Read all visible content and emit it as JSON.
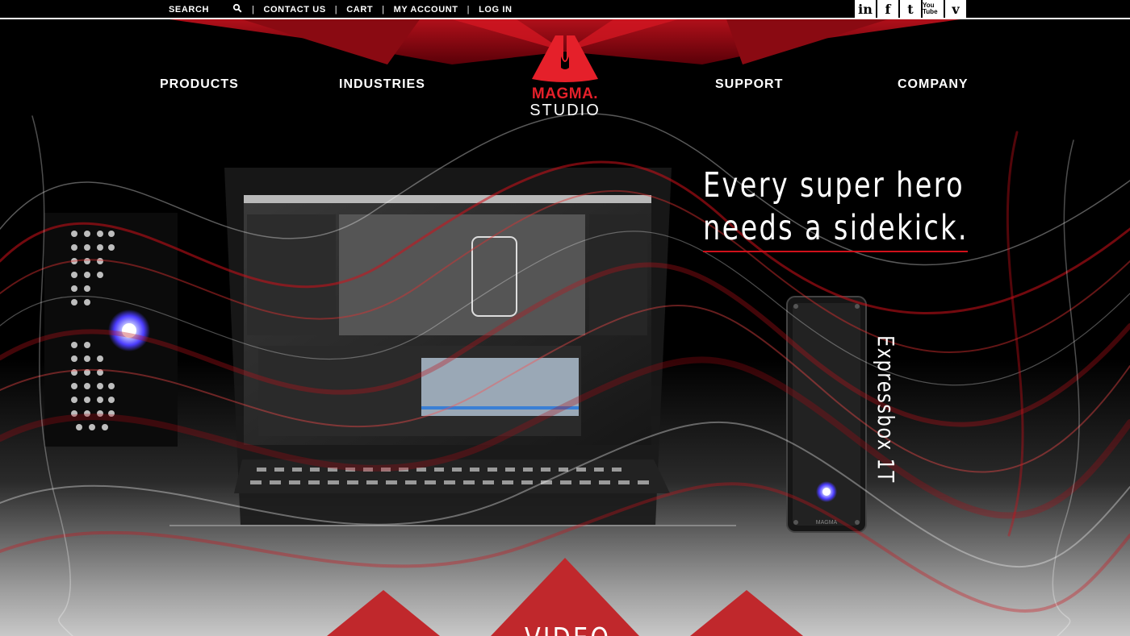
{
  "topbar": {
    "search_label": "SEARCH",
    "links": [
      "CONTACT US",
      "CART",
      "MY ACCOUNT",
      "LOG IN"
    ],
    "social": [
      "in",
      "f",
      "t",
      "You Tube",
      "v"
    ]
  },
  "nav": {
    "products": "PRODUCTS",
    "industries": "INDUSTRIES",
    "support": "SUPPORT",
    "company": "COMPANY"
  },
  "logo": {
    "brand": "MAGMA.",
    "sub": "STUDIO"
  },
  "hero": {
    "headline_line1": "Every super hero",
    "headline_line2": "needs a sidekick.",
    "product_name": "Expressbox 1T",
    "device_brand": "MAGMA",
    "section_label": "VIDEO"
  },
  "colors": {
    "accent_red": "#d0101a",
    "background": "#000000",
    "text": "#ffffff"
  },
  "icons": [
    "search-icon",
    "linkedin-icon",
    "facebook-icon",
    "tumblr-icon",
    "youtube-icon",
    "vimeo-icon"
  ]
}
